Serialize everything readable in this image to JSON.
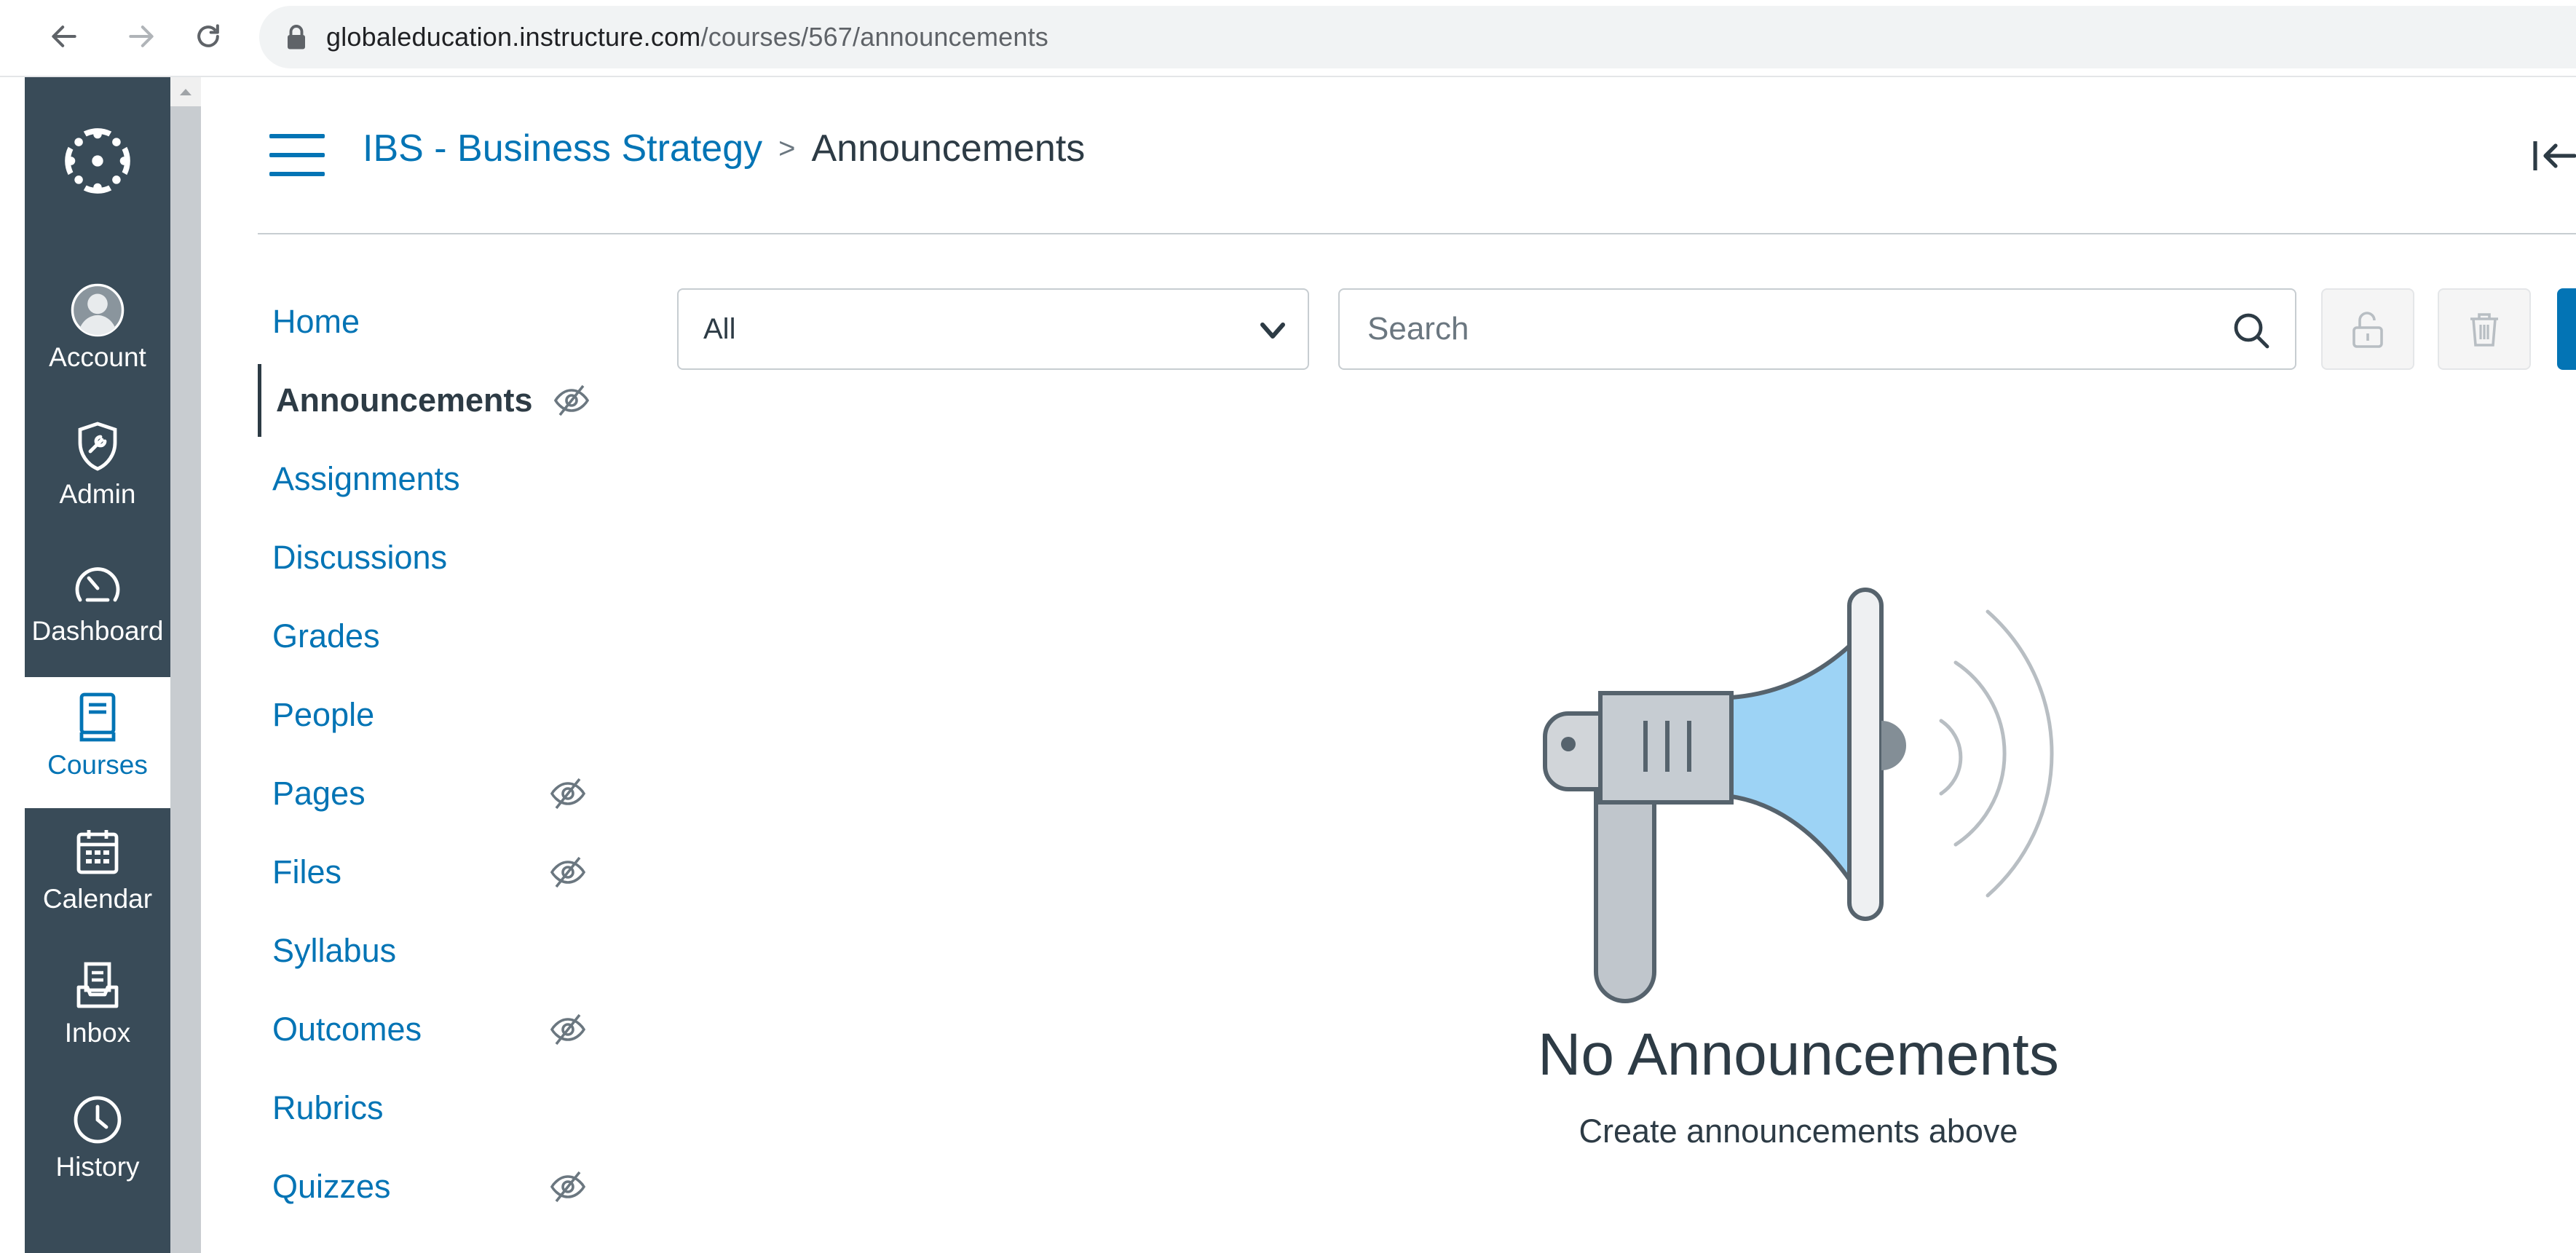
{
  "browser": {
    "url_host": "globaleducation.instructure.com",
    "url_path": "/courses/567/announcements"
  },
  "global_nav": {
    "items": [
      {
        "label": "Account",
        "icon": "user-avatar-icon"
      },
      {
        "label": "Admin",
        "icon": "shield-wrench-icon"
      },
      {
        "label": "Dashboard",
        "icon": "speedometer-icon"
      },
      {
        "label": "Courses",
        "icon": "book-icon",
        "active": true
      },
      {
        "label": "Calendar",
        "icon": "calendar-icon"
      },
      {
        "label": "Inbox",
        "icon": "inbox-tray-icon"
      },
      {
        "label": "History",
        "icon": "clock-icon"
      }
    ]
  },
  "header": {
    "course_name": "IBS - Business Strategy",
    "separator": ">",
    "current_page": "Announcements"
  },
  "course_nav": {
    "items": [
      {
        "label": "Home",
        "hidden": false
      },
      {
        "label": "Announcements",
        "hidden": true,
        "active": true
      },
      {
        "label": "Assignments",
        "hidden": false
      },
      {
        "label": "Discussions",
        "hidden": false
      },
      {
        "label": "Grades",
        "hidden": false
      },
      {
        "label": "People",
        "hidden": false
      },
      {
        "label": "Pages",
        "hidden": true
      },
      {
        "label": "Files",
        "hidden": true
      },
      {
        "label": "Syllabus",
        "hidden": false
      },
      {
        "label": "Outcomes",
        "hidden": true
      },
      {
        "label": "Rubrics",
        "hidden": false
      },
      {
        "label": "Quizzes",
        "hidden": true
      }
    ]
  },
  "toolbar": {
    "filter_value": "All",
    "search_placeholder": "Search"
  },
  "empty_state": {
    "title": "No Announcements",
    "subtitle": "Create announcements above"
  },
  "colors": {
    "link_blue": "#0374b5",
    "nav_bg": "#394b58",
    "text": "#2d3b45",
    "megaphone_blue": "#9dd3f5"
  }
}
